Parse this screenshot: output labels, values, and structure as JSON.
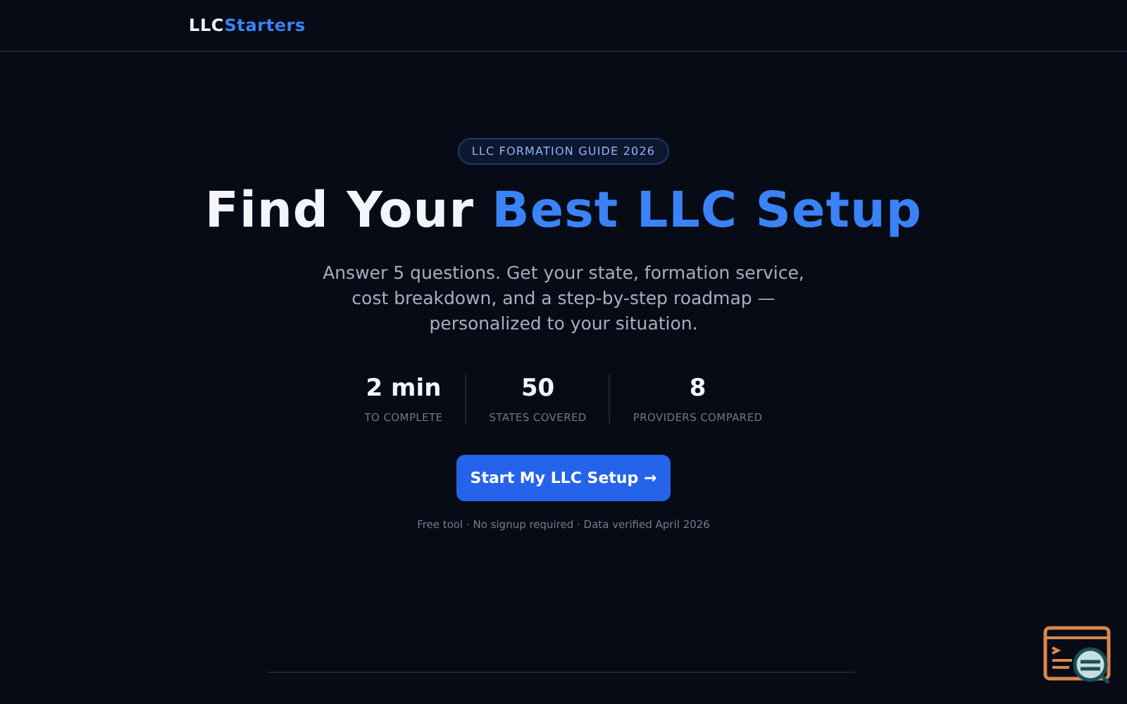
{
  "header": {
    "logo": {
      "prefix": "LLC",
      "accent": "Starters"
    }
  },
  "hero": {
    "badge": "LLC FORMATION GUIDE 2026",
    "title": {
      "plain": "Find Your ",
      "accent": "Best LLC Setup"
    },
    "subtitle": "Answer 5 questions. Get your state, formation service, cost breakdown, and a step-by-step roadmap — personalized to your situation.",
    "stats": [
      {
        "value": "2 min",
        "label": "TO COMPLETE"
      },
      {
        "value": "50",
        "label": "STATES COVERED"
      },
      {
        "value": "8",
        "label": "PROVIDERS COMPARED"
      }
    ],
    "cta": "Start My LLC Setup →",
    "footnote": "Free tool · No signup required · Data verified April 2026"
  }
}
